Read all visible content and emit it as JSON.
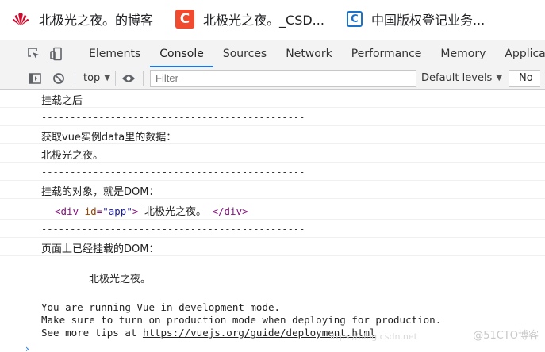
{
  "bookmarks": [
    {
      "label": "北极光之夜。的博客",
      "icon": "huawei-icon"
    },
    {
      "label": "北极光之夜。_CSD...",
      "icon": "csdn-icon",
      "glyph": "C"
    },
    {
      "label": "中国版权登记业务...",
      "icon": "copyright-icon",
      "glyph": "C"
    }
  ],
  "devtools": {
    "tabs": [
      "Elements",
      "Console",
      "Sources",
      "Network",
      "Performance",
      "Memory",
      "Application"
    ],
    "active_tab": "Console"
  },
  "console_toolbar": {
    "context": "top",
    "filter_placeholder": "Filter",
    "levels": "Default levels",
    "no_issues": "No"
  },
  "console": {
    "line1": "挂载之后",
    "dash1": "----------------------------------------------",
    "line2": "获取vue实例data里的数据：",
    "line3": "北极光之夜。",
    "dash2": "----------------------------------------------",
    "line4": "挂载的对象，就是DOM：",
    "dom_tag_open": "<div",
    "dom_attr": "id",
    "dom_val": "\"app\"",
    "dom_text": "北极光之夜。",
    "dom_tag_close": "</div>",
    "dash3": "----------------------------------------------",
    "line5": "页面上已经挂载的DOM：",
    "rendered": "北极光之夜。",
    "vue_msg1": "You are running Vue in development mode.",
    "vue_msg2": "Make sure to turn on production mode when deploying for production.",
    "vue_msg3_prefix": "See more tips at ",
    "vue_msg3_link": "https://vuejs.org/guide/deployment.html",
    "prompt": "›"
  },
  "watermark": "@51CTO博客",
  "watermark_url": "https://blog.csdn.net"
}
